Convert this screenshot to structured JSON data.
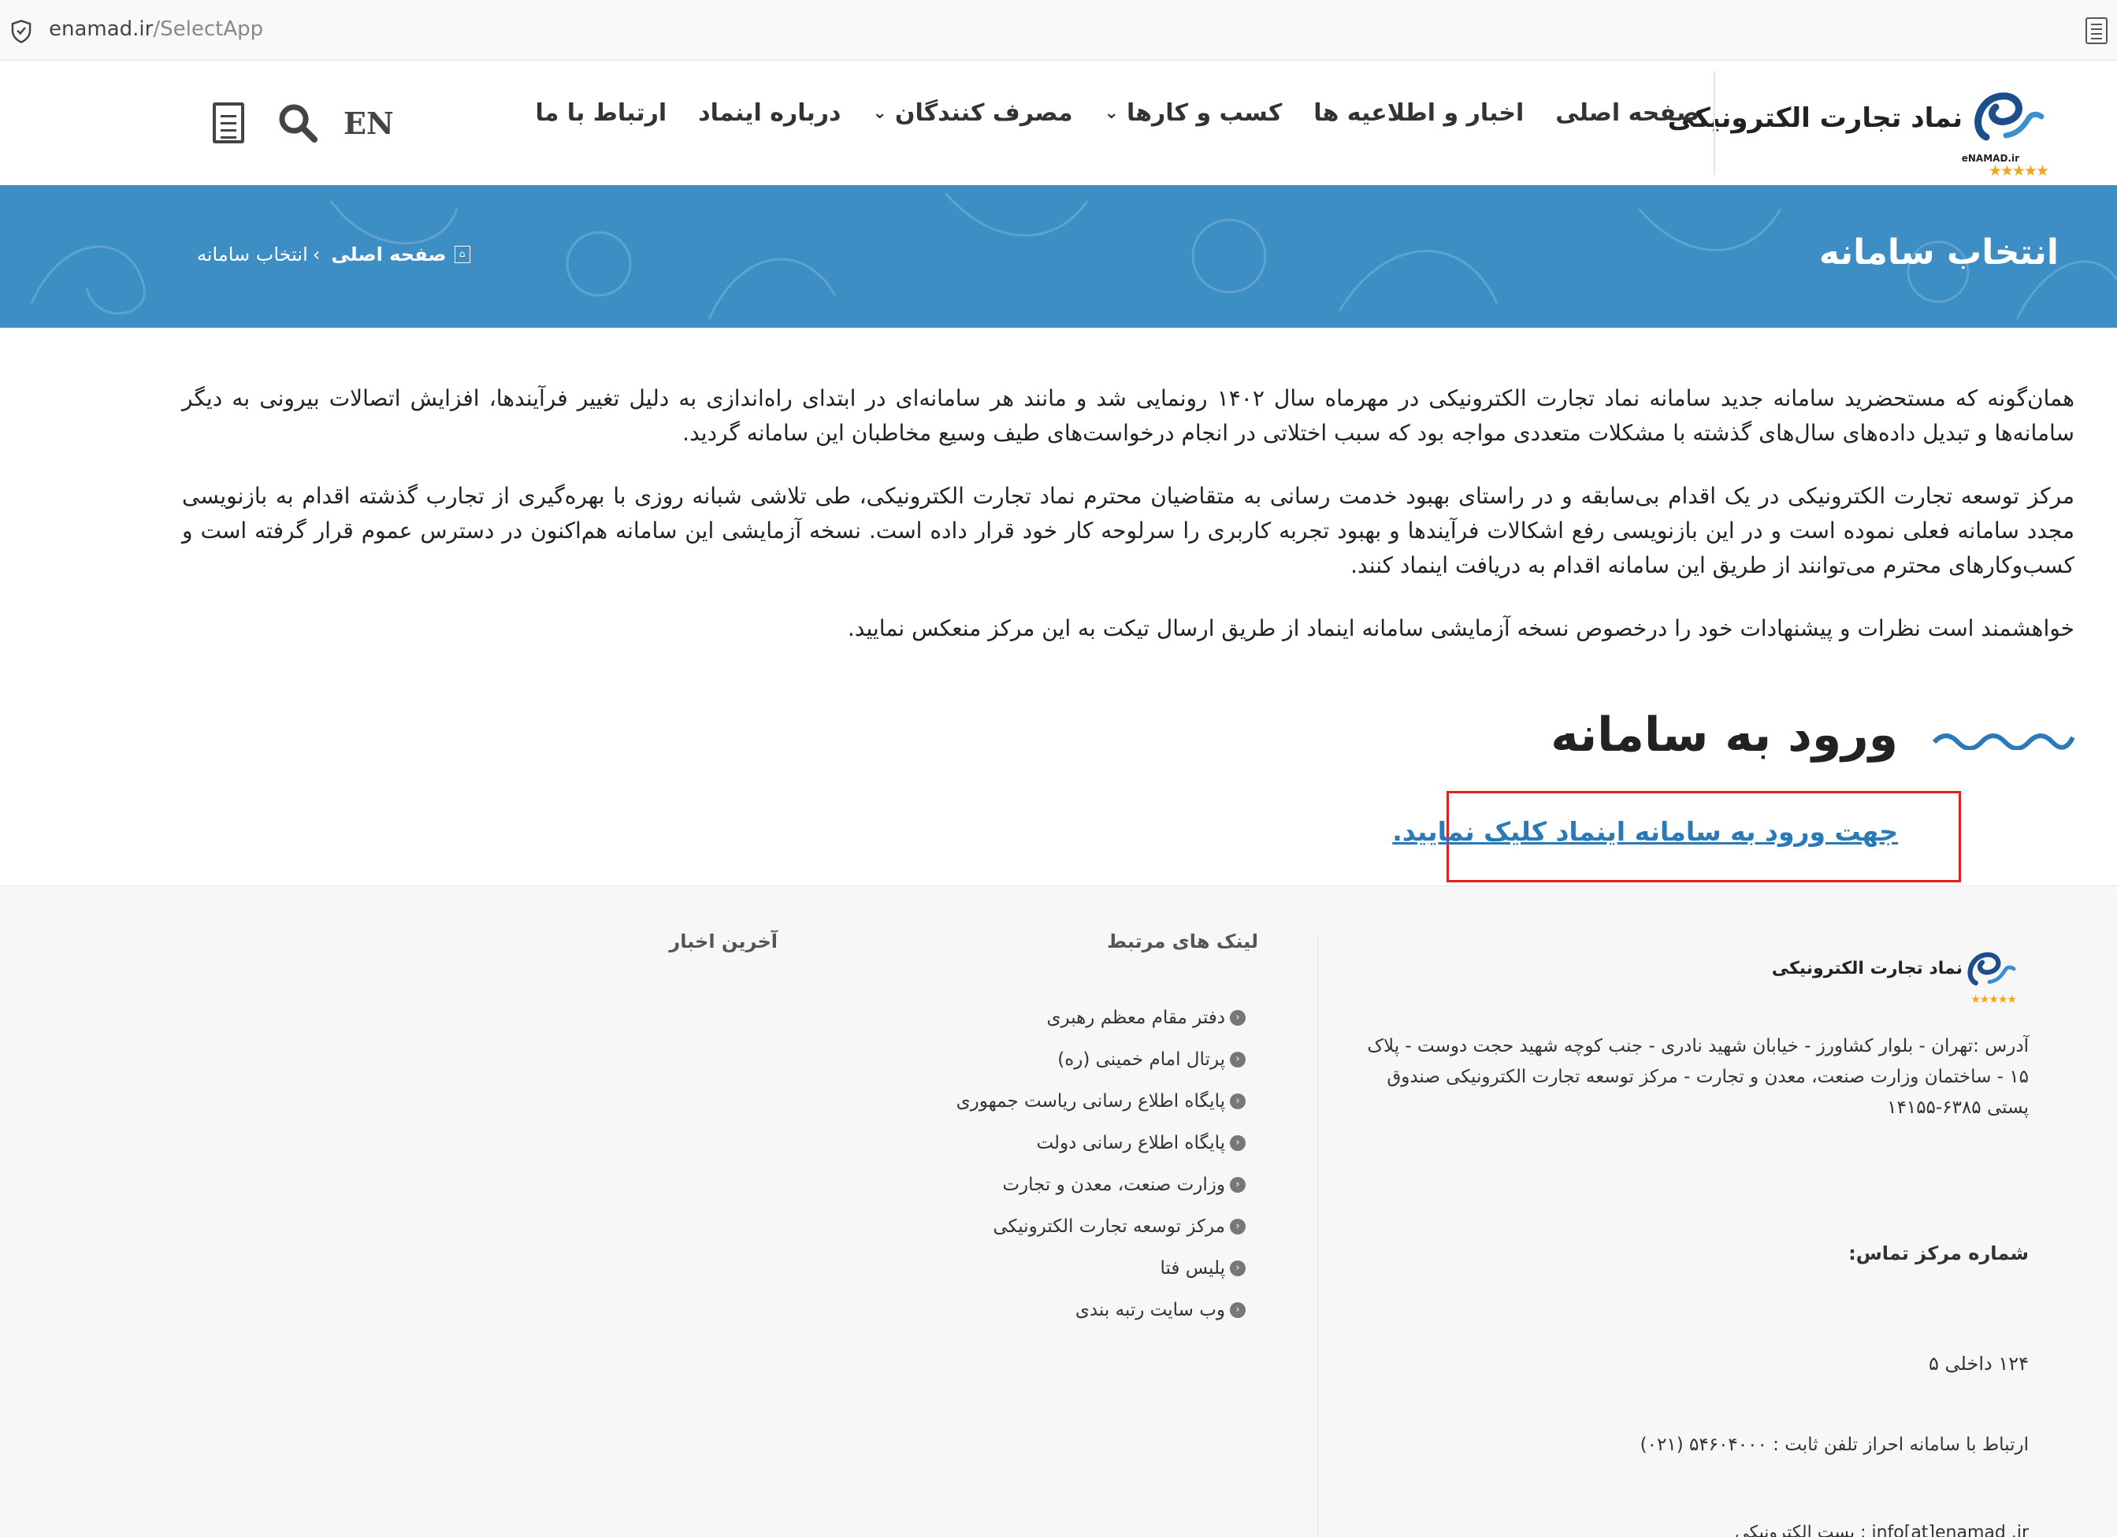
{
  "browser": {
    "url_host": "enamad.ir",
    "url_path": "/SelectApp"
  },
  "header": {
    "logo": {
      "text": "نماد تجارت الکترونیکی",
      "sub": "eNAMAD.ir",
      "stars": "★★★★★"
    },
    "nav": [
      {
        "label": "صفحه اصلی",
        "has_dropdown": false
      },
      {
        "label": "اخبار و اطلاعیه ها",
        "has_dropdown": false
      },
      {
        "label": "کسب و کارها",
        "has_dropdown": true
      },
      {
        "label": "مصرف کنندگان",
        "has_dropdown": true
      },
      {
        "label": "درباره اینماد",
        "has_dropdown": false
      },
      {
        "label": "ارتباط با ما",
        "has_dropdown": false
      }
    ],
    "lang_label": "EN",
    "icons": [
      "document-icon",
      "search-icon"
    ]
  },
  "banner": {
    "title": "انتخاب سامانه",
    "breadcrumb_home": "صفحه اصلی",
    "breadcrumb_sep": "›",
    "breadcrumb_current": "انتخاب سامانه",
    "color": "#3d8ec4"
  },
  "content": {
    "paragraphs": [
      "همان‌گونه که مستحضرید سامانه جدید سامانه نماد تجارت الکترونیکی در مهرماه سال ۱۴۰۲ رونمایی شد و مانند هر سامانه‌ای در ابتدای راه‌اندازی به دلیل تغییر فرآیندها، افزایش اتصالات بیرونی به دیگر سامانه‌ها و تبدیل داده‌های سال‌های گذشته با مشکلات متعددی مواجه بود که سبب اختلاتی در انجام درخواست‌های طیف وسیع مخاطبان این سامانه گردید.",
      "مرکز توسعه تجارت الکترونیکی در یک اقدام بی‌سابقه و در راستای بهبود خدمت رسانی به متقاضیان محترم نماد تجارت الکترونیکی، طی تلاشی شبانه روزی با بهره‌گیری از تجارب گذشته اقدام به بازنویسی مجدد سامانه فعلی نموده است و در این بازنویسی رفع اشکالات فرآیندها و بهبود تجربه کاربری را سرلوحه کار خود قرار داده است. نسخه آزمایشی این سامانه هم‌اکنون در دسترس عموم قرار گرفته است و کسب‌وکارهای محترم می‌توانند از طریق این سامانه اقدام به دریافت اینماد کنند.",
      "خواهشمند است نظرات و پیشنهادات خود را درخصوص نسخه آزمایشی سامانه اینماد از طریق ارسال تیکت به این مرکز منعکس نمایید."
    ]
  },
  "login": {
    "title": "ورود به سامانه",
    "link_text": "جهت ورود به سامانه اینماد کلیک نمایید.",
    "link_color": "#2a7ab8",
    "highlight_color": "#e02020"
  },
  "footer": {
    "logo_text": "نماد تجارت الکترونیکی",
    "stars": "★★★★★",
    "address": "آدرس :تهران - بلوار کشاورز - خیابان شهید نادری - جنب کوچه شهید حجت دوست - پلاک ۱۵ - ساختمان وزارت صنعت، معدن و تجارت - مرکز توسعه تجارت الکترونیکی صندوق پستی ۶۳۸۵-۱۴۱۵۵",
    "contact_label": "شماره مرکز تماس:",
    "contact_ext": "۱۲۴ داخلی ۵",
    "contact_phone": "ارتباط با سامانه احراز تلفن ثابت : ۵۴۶۰۴۰۰۰ (۰۲۱)",
    "contact_email": "info[at]enamad .ir : پست الکترونیکی",
    "links_title": "لینک های مرتبط",
    "links": [
      "دفتر مقام معظم رهبری",
      "پرتال امام خمینی (ره)",
      "پایگاه اطلاع رسانی ریاست جمهوری",
      "پایگاه اطلاع رسانی دولت",
      "وزارت صنعت، معدن و تجارت",
      "مرکز توسعه تجارت الکترونیکی",
      "پلیس فتا",
      "وب سایت رتبه بندی"
    ],
    "news_title": "آخرین اخبار"
  }
}
